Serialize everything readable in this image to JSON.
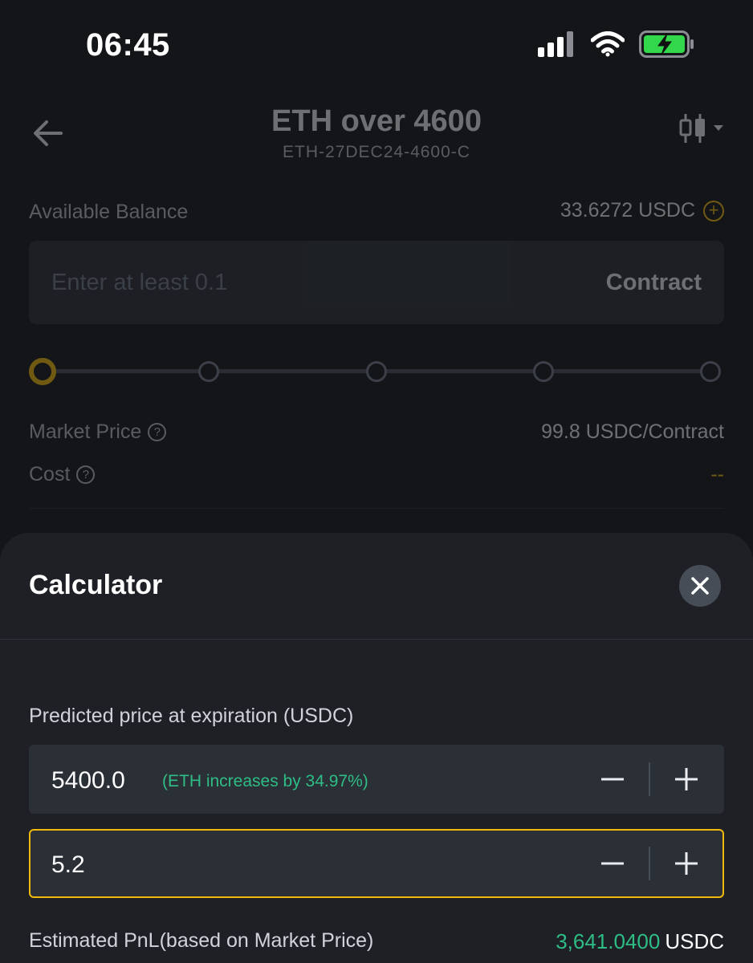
{
  "status_bar": {
    "time": "06:45",
    "icons": [
      "signal-icon",
      "wifi-icon",
      "battery-charging-icon"
    ]
  },
  "header": {
    "title": "ETH over 4600",
    "subtitle": "ETH-27DEC24-4600-C",
    "back_icon": "back-arrow-icon",
    "chart_icon": "candlestick-icon"
  },
  "balance": {
    "label": "Available Balance",
    "value": "33.6272 USDC"
  },
  "quantity_input": {
    "placeholder": "Enter at least 0.1",
    "unit": "Contract"
  },
  "slider": {
    "steps": 5,
    "value_percent": 0
  },
  "market_price": {
    "label": "Market Price",
    "value": "99.8 USDC/Contract"
  },
  "cost": {
    "label": "Cost",
    "value": "--"
  },
  "calculator": {
    "title": "Calculator",
    "predicted_label": "Predicted price at expiration (USDC)",
    "predicted_value": "5400.0",
    "predicted_hint": "(ETH increases by 34.97%)",
    "quantity_value": "5.2",
    "pnl_label": "Estimated PnL(based on Market Price)",
    "pnl_value": "3,641.0400",
    "pnl_unit": "USDC"
  },
  "colors": {
    "accent": "#f0b90b",
    "positive": "#2ebd85",
    "background": "#141518",
    "sheet": "#1e2026"
  }
}
